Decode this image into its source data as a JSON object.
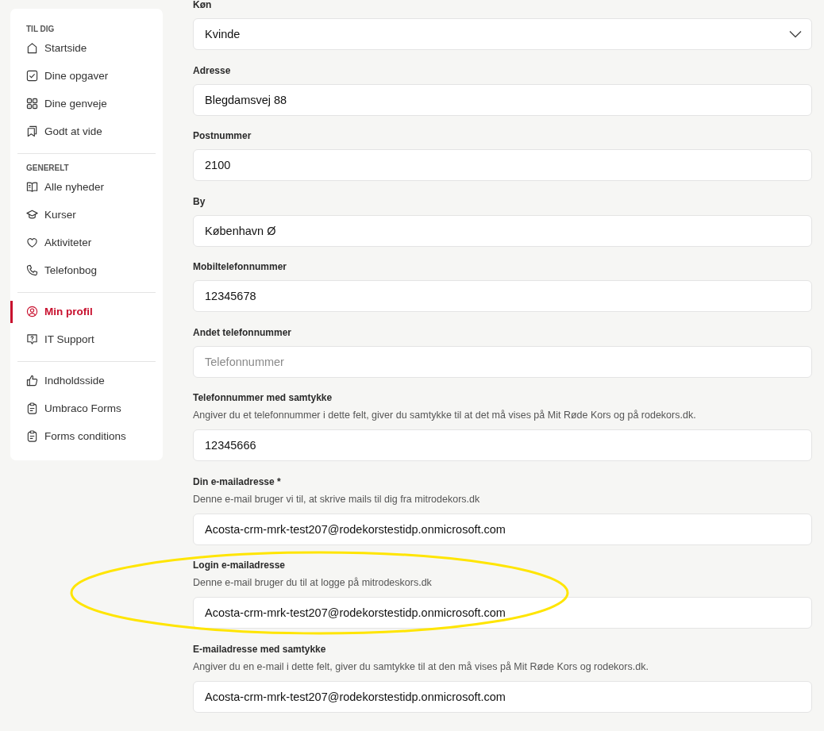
{
  "sidebar": {
    "sections": [
      {
        "heading": "TIL DIG",
        "items": [
          {
            "label": "Startside",
            "selected": false
          },
          {
            "label": "Dine opgaver",
            "selected": false
          },
          {
            "label": "Dine genveje",
            "selected": false
          },
          {
            "label": "Godt at vide",
            "selected": false
          }
        ]
      },
      {
        "heading": "GENERELT",
        "items": [
          {
            "label": "Alle nyheder",
            "selected": false
          },
          {
            "label": "Kurser",
            "selected": false
          },
          {
            "label": "Aktiviteter",
            "selected": false
          },
          {
            "label": "Telefonbog",
            "selected": false
          }
        ]
      },
      {
        "items": [
          {
            "label": "Min profil",
            "selected": true
          },
          {
            "label": "IT Support",
            "selected": false
          }
        ]
      },
      {
        "items": [
          {
            "label": "Indholdsside",
            "selected": false
          },
          {
            "label": "Umbraco Forms",
            "selected": false
          },
          {
            "label": "Forms conditions",
            "selected": false
          }
        ]
      }
    ]
  },
  "form": {
    "fields": [
      {
        "kind": "select",
        "label": "Køn",
        "value": "Kvinde",
        "highlighted": false
      },
      {
        "kind": "text",
        "label": "Adresse",
        "value": "Blegdamsvej 88",
        "highlighted": false
      },
      {
        "kind": "text",
        "label": "Postnummer",
        "value": "2100",
        "highlighted": false
      },
      {
        "kind": "text",
        "label": "By",
        "value": "København Ø",
        "highlighted": false
      },
      {
        "kind": "text",
        "label": "Mobiltelefonnummer",
        "value": "12345678",
        "highlighted": false
      },
      {
        "kind": "text",
        "label": "Andet telefonnummer",
        "placeholder": "Telefonnummer",
        "highlighted": false
      },
      {
        "kind": "text",
        "label": "Telefonnummer med samtykke",
        "description": "Angiver du et telefonnummer i dette felt, giver du samtykke til at det må vises på Mit Røde Kors og på rodekors.dk.",
        "value": "12345666",
        "highlighted": false
      },
      {
        "kind": "text",
        "label": "Din e-mailadresse *",
        "description": "Denne e-mail bruger vi til, at skrive mails til dig fra mitrodekors.dk",
        "value": "Acosta-crm-mrk-test207@rodekorstestidp.onmicrosoft.com",
        "highlighted": false
      },
      {
        "kind": "text",
        "label": "Login e-mailadresse",
        "description": "Denne e-mail bruger du til at logge på mitrodeskors.dk",
        "value": "Acosta-crm-mrk-test207@rodekorstestidp.onmicrosoft.com",
        "highlighted": true
      },
      {
        "kind": "text",
        "label": "E-mailadresse med samtykke",
        "description": "Angiver du en e-mail i dette felt, giver du samtykke til at den må vises på Mit Røde Kors og rodekors.dk.",
        "value": "Acosta-crm-mrk-test207@rodekorstestidp.onmicrosoft.com",
        "highlighted": false
      }
    ]
  }
}
